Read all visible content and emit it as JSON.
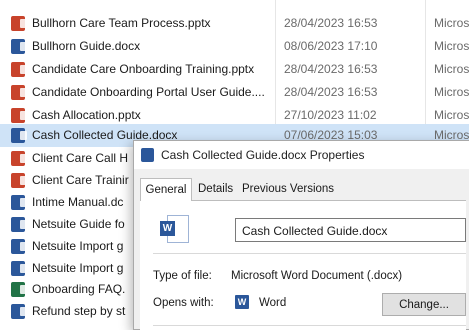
{
  "explorer": {
    "rows": [
      {
        "name": "Bullhorn Care Team Process.pptx",
        "date": "28/04/2023 16:53",
        "type": "Micros",
        "icon": "powerpoint-icon"
      },
      {
        "name": "Bullhorn Guide.docx",
        "date": "08/06/2023 17:10",
        "type": "Micros",
        "icon": "word-icon"
      },
      {
        "name": "Candidate Care Onboarding Training.pptx",
        "date": "28/04/2023 16:53",
        "type": "Micros",
        "icon": "powerpoint-icon"
      },
      {
        "name": "Candidate Onboarding Portal User Guide....",
        "date": "28/04/2023 16:53",
        "type": "Micros",
        "icon": "powerpoint-icon"
      },
      {
        "name": "Cash Allocation.pptx",
        "date": "27/10/2023 11:02",
        "type": "Micros",
        "icon": "powerpoint-icon"
      },
      {
        "name": "Cash Collected Guide.docx",
        "date": "07/06/2023 15:03",
        "type": "Micros",
        "icon": "word-icon"
      },
      {
        "name": "Client Care Call H",
        "date": "",
        "type": "",
        "icon": "powerpoint-icon"
      },
      {
        "name": "Client Care Trainir",
        "date": "",
        "type": "",
        "icon": "powerpoint-icon"
      },
      {
        "name": "Intime Manual.dc",
        "date": "",
        "type": "",
        "icon": "word-icon"
      },
      {
        "name": "Netsuite Guide fo",
        "date": "",
        "type": "",
        "icon": "word-icon"
      },
      {
        "name": "Netsuite Import g",
        "date": "",
        "type": "",
        "icon": "word-icon"
      },
      {
        "name": "Netsuite Import g",
        "date": "",
        "type": "",
        "icon": "word-icon"
      },
      {
        "name": "Onboarding FAQ.",
        "date": "",
        "type": "",
        "icon": "excel-icon"
      },
      {
        "name": "Refund step by st",
        "date": "",
        "type": "",
        "icon": "word-icon"
      }
    ],
    "selected_index": 5,
    "colors": {
      "selected_row": "#cfe3f7",
      "word": "#2b579a",
      "powerpoint": "#c8432b",
      "excel": "#217346"
    }
  },
  "dialog": {
    "title": "Cash Collected Guide.docx Properties",
    "tabs": [
      "General",
      "Details",
      "Previous Versions"
    ],
    "active_tab": "General",
    "file_name": "Cash Collected Guide.docx",
    "type_label": "Type of file:",
    "type_value": "Microsoft Word Document (.docx)",
    "opens_label": "Opens with:",
    "opens_value": "Word",
    "change_button": "Change..."
  }
}
